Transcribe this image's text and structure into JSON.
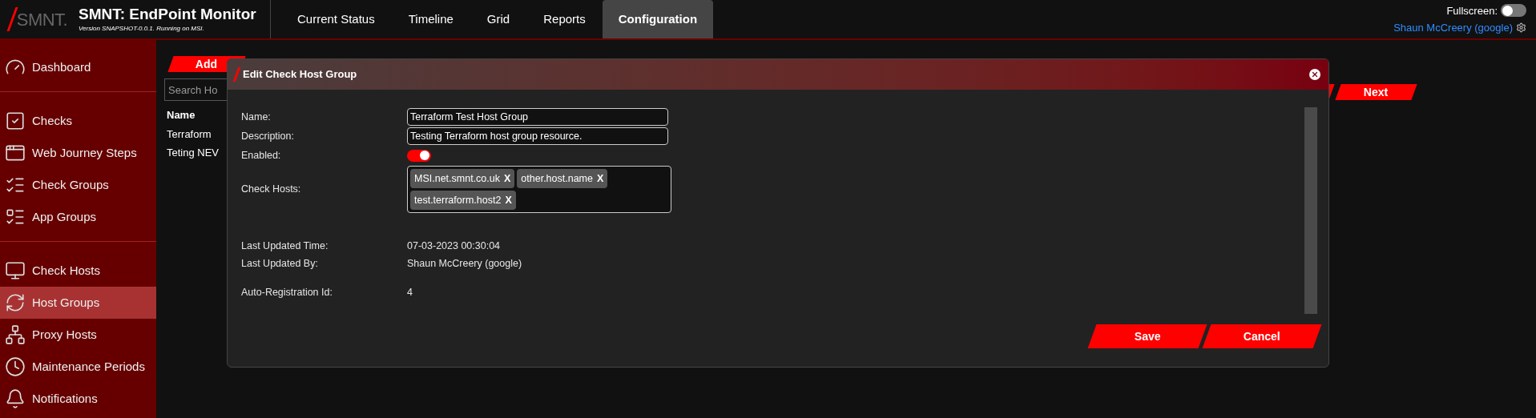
{
  "header": {
    "logo_text": "SMNT.",
    "title": "SMNT: EndPoint Monitor",
    "version": "Version SNAPSHOT-0.0.1. Running on MSI.",
    "nav": [
      {
        "label": "Current Status",
        "selected": false
      },
      {
        "label": "Timeline",
        "selected": false
      },
      {
        "label": "Grid",
        "selected": false
      },
      {
        "label": "Reports",
        "selected": false
      },
      {
        "label": "Configuration",
        "selected": true
      }
    ],
    "fullscreen": {
      "label": "Fullscreen:",
      "on": false
    },
    "user": "Shaun McCreery (google)"
  },
  "sidebar": {
    "sections": [
      {
        "items": [
          {
            "label": "Dashboard",
            "selected": false
          }
        ]
      },
      {
        "items": [
          {
            "label": "Checks",
            "selected": false
          },
          {
            "label": "Web Journey Steps",
            "selected": false
          },
          {
            "label": "Check Groups",
            "selected": false
          },
          {
            "label": "App Groups",
            "selected": false
          }
        ]
      },
      {
        "items": [
          {
            "label": "Check Hosts",
            "selected": false
          },
          {
            "label": "Host Groups",
            "selected": true
          },
          {
            "label": "Proxy Hosts",
            "selected": false
          },
          {
            "label": "Maintenance Periods",
            "selected": false
          },
          {
            "label": "Notifications",
            "selected": false
          }
        ]
      }
    ]
  },
  "list": {
    "add_button": "Add",
    "search": {
      "placeholder": "Search Ho"
    },
    "columns": [
      "Name"
    ],
    "rows": [
      "Terraform",
      "Teting NEV"
    ],
    "next_button": "Next"
  },
  "modal": {
    "title": "Edit Check Host Group",
    "fields": [
      {
        "kind": "input",
        "label": "Name:",
        "value": "Terraform Test Host Group"
      },
      {
        "kind": "input",
        "label": "Description:",
        "value": "Testing Terraform host group resource."
      },
      {
        "kind": "toggle",
        "label": "Enabled:",
        "on": true
      },
      {
        "kind": "tags",
        "label": "Check Hosts:",
        "tags": [
          {
            "label": "MSI.net.smnt.co.uk",
            "remove": "X"
          },
          {
            "label": "other.host.name",
            "remove": "X"
          },
          {
            "label": "test.terraform.host2",
            "remove": "X"
          }
        ]
      },
      {
        "kind": "gap"
      },
      {
        "kind": "static",
        "label": "Last Updated Time:",
        "value": "07-03-2023 00:30:04"
      },
      {
        "kind": "static",
        "label": "Last Updated By:",
        "value": "Shaun McCreery (google)"
      },
      {
        "kind": "gap"
      },
      {
        "kind": "static",
        "label": "Auto-Registration Id:",
        "value": "4"
      }
    ],
    "actions": [
      "Save",
      "Cancel"
    ]
  }
}
